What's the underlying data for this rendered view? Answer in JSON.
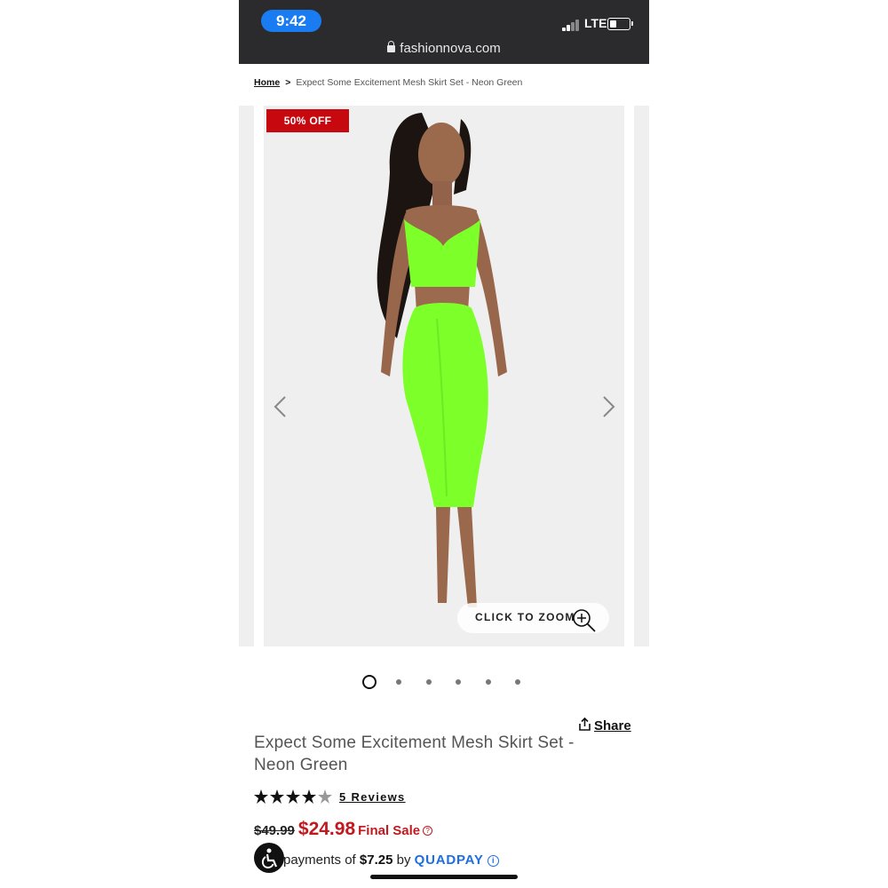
{
  "status_bar": {
    "time": "9:42",
    "network": "LTE",
    "url": "fashionnova.com"
  },
  "breadcrumb": {
    "home": "Home",
    "separator": ">",
    "current": "Expect Some Excitement Mesh Skirt Set - Neon Green"
  },
  "gallery": {
    "badge": "50% OFF",
    "zoom_label": "CLICK TO ZOOM",
    "slide_count": 6,
    "active_slide": 1,
    "colors": {
      "background": "#efefef",
      "garment": "#7dff2a",
      "badge": "#c8080f"
    }
  },
  "product": {
    "share_label": "Share",
    "title": "Expect Some Excitement Mesh Skirt Set - Neon Green",
    "rating": 4,
    "rating_max": 5,
    "reviews_label": "5 Reviews",
    "old_price": "$49.99",
    "new_price": "$24.98",
    "final_sale": "Final Sale",
    "payments_prefix": "payments of",
    "payment_amount": "$7.25",
    "payments_by": "by",
    "provider": "QUADPAY"
  },
  "icons": [
    "lock-icon",
    "share-icon",
    "zoom-in-icon",
    "chevron-left-icon",
    "chevron-right-icon",
    "star-icon",
    "accessibility-icon",
    "info-icon",
    "help-icon"
  ]
}
